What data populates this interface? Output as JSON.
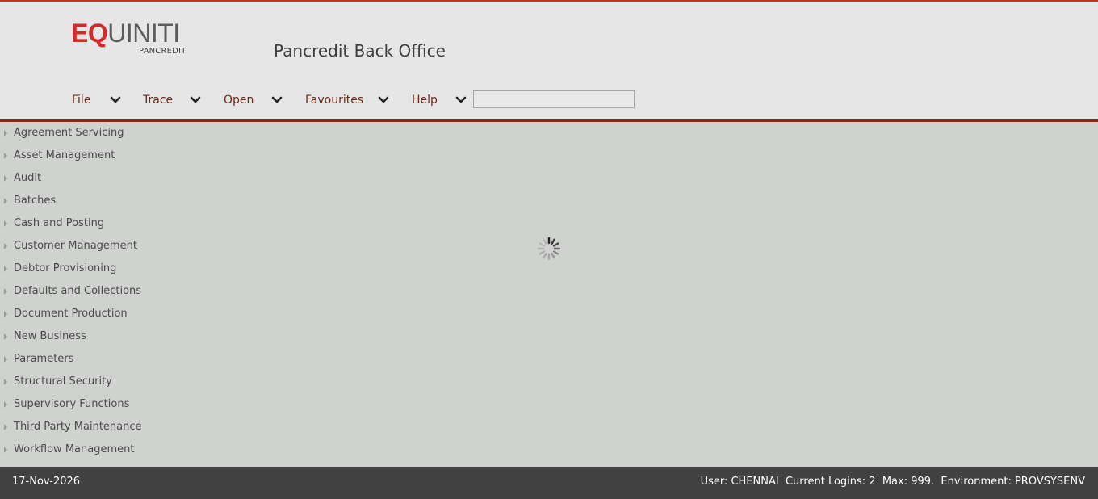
{
  "brand": {
    "logo_eq": "EQ",
    "logo_rest": "UINITI",
    "logo_sub": "PANCREDIT",
    "app_title": "Pancredit Back Office",
    "accent": "#d42a2a",
    "rule_color": "#7b2e16"
  },
  "menu": {
    "items": [
      {
        "label": "File",
        "icon": "chevron-down-icon"
      },
      {
        "label": "Trace",
        "icon": "chevron-down-icon"
      },
      {
        "label": "Open",
        "icon": "chevron-down-icon"
      },
      {
        "label": "Favourites",
        "icon": "chevron-down-icon"
      },
      {
        "label": "Help",
        "icon": "chevron-down-icon"
      }
    ],
    "search_value": ""
  },
  "nav": {
    "items": [
      {
        "label": "Agreement Servicing"
      },
      {
        "label": "Asset Management"
      },
      {
        "label": "Audit"
      },
      {
        "label": "Batches"
      },
      {
        "label": "Cash and Posting"
      },
      {
        "label": "Customer Management"
      },
      {
        "label": "Debtor Provisioning"
      },
      {
        "label": "Defaults and Collections"
      },
      {
        "label": "Document Production"
      },
      {
        "label": "New Business"
      },
      {
        "label": "Parameters"
      },
      {
        "label": "Structural Security"
      },
      {
        "label": "Supervisory Functions"
      },
      {
        "label": "Third Party Maintenance"
      },
      {
        "label": "Workflow Management"
      }
    ]
  },
  "main": {
    "loading_icon": "loading-spinner-icon"
  },
  "footer": {
    "date": "17-Nov-2026",
    "status": "User: CHENNAI  Current Logins: 2  Max: 999.  Environment: PROVSYSENV"
  }
}
